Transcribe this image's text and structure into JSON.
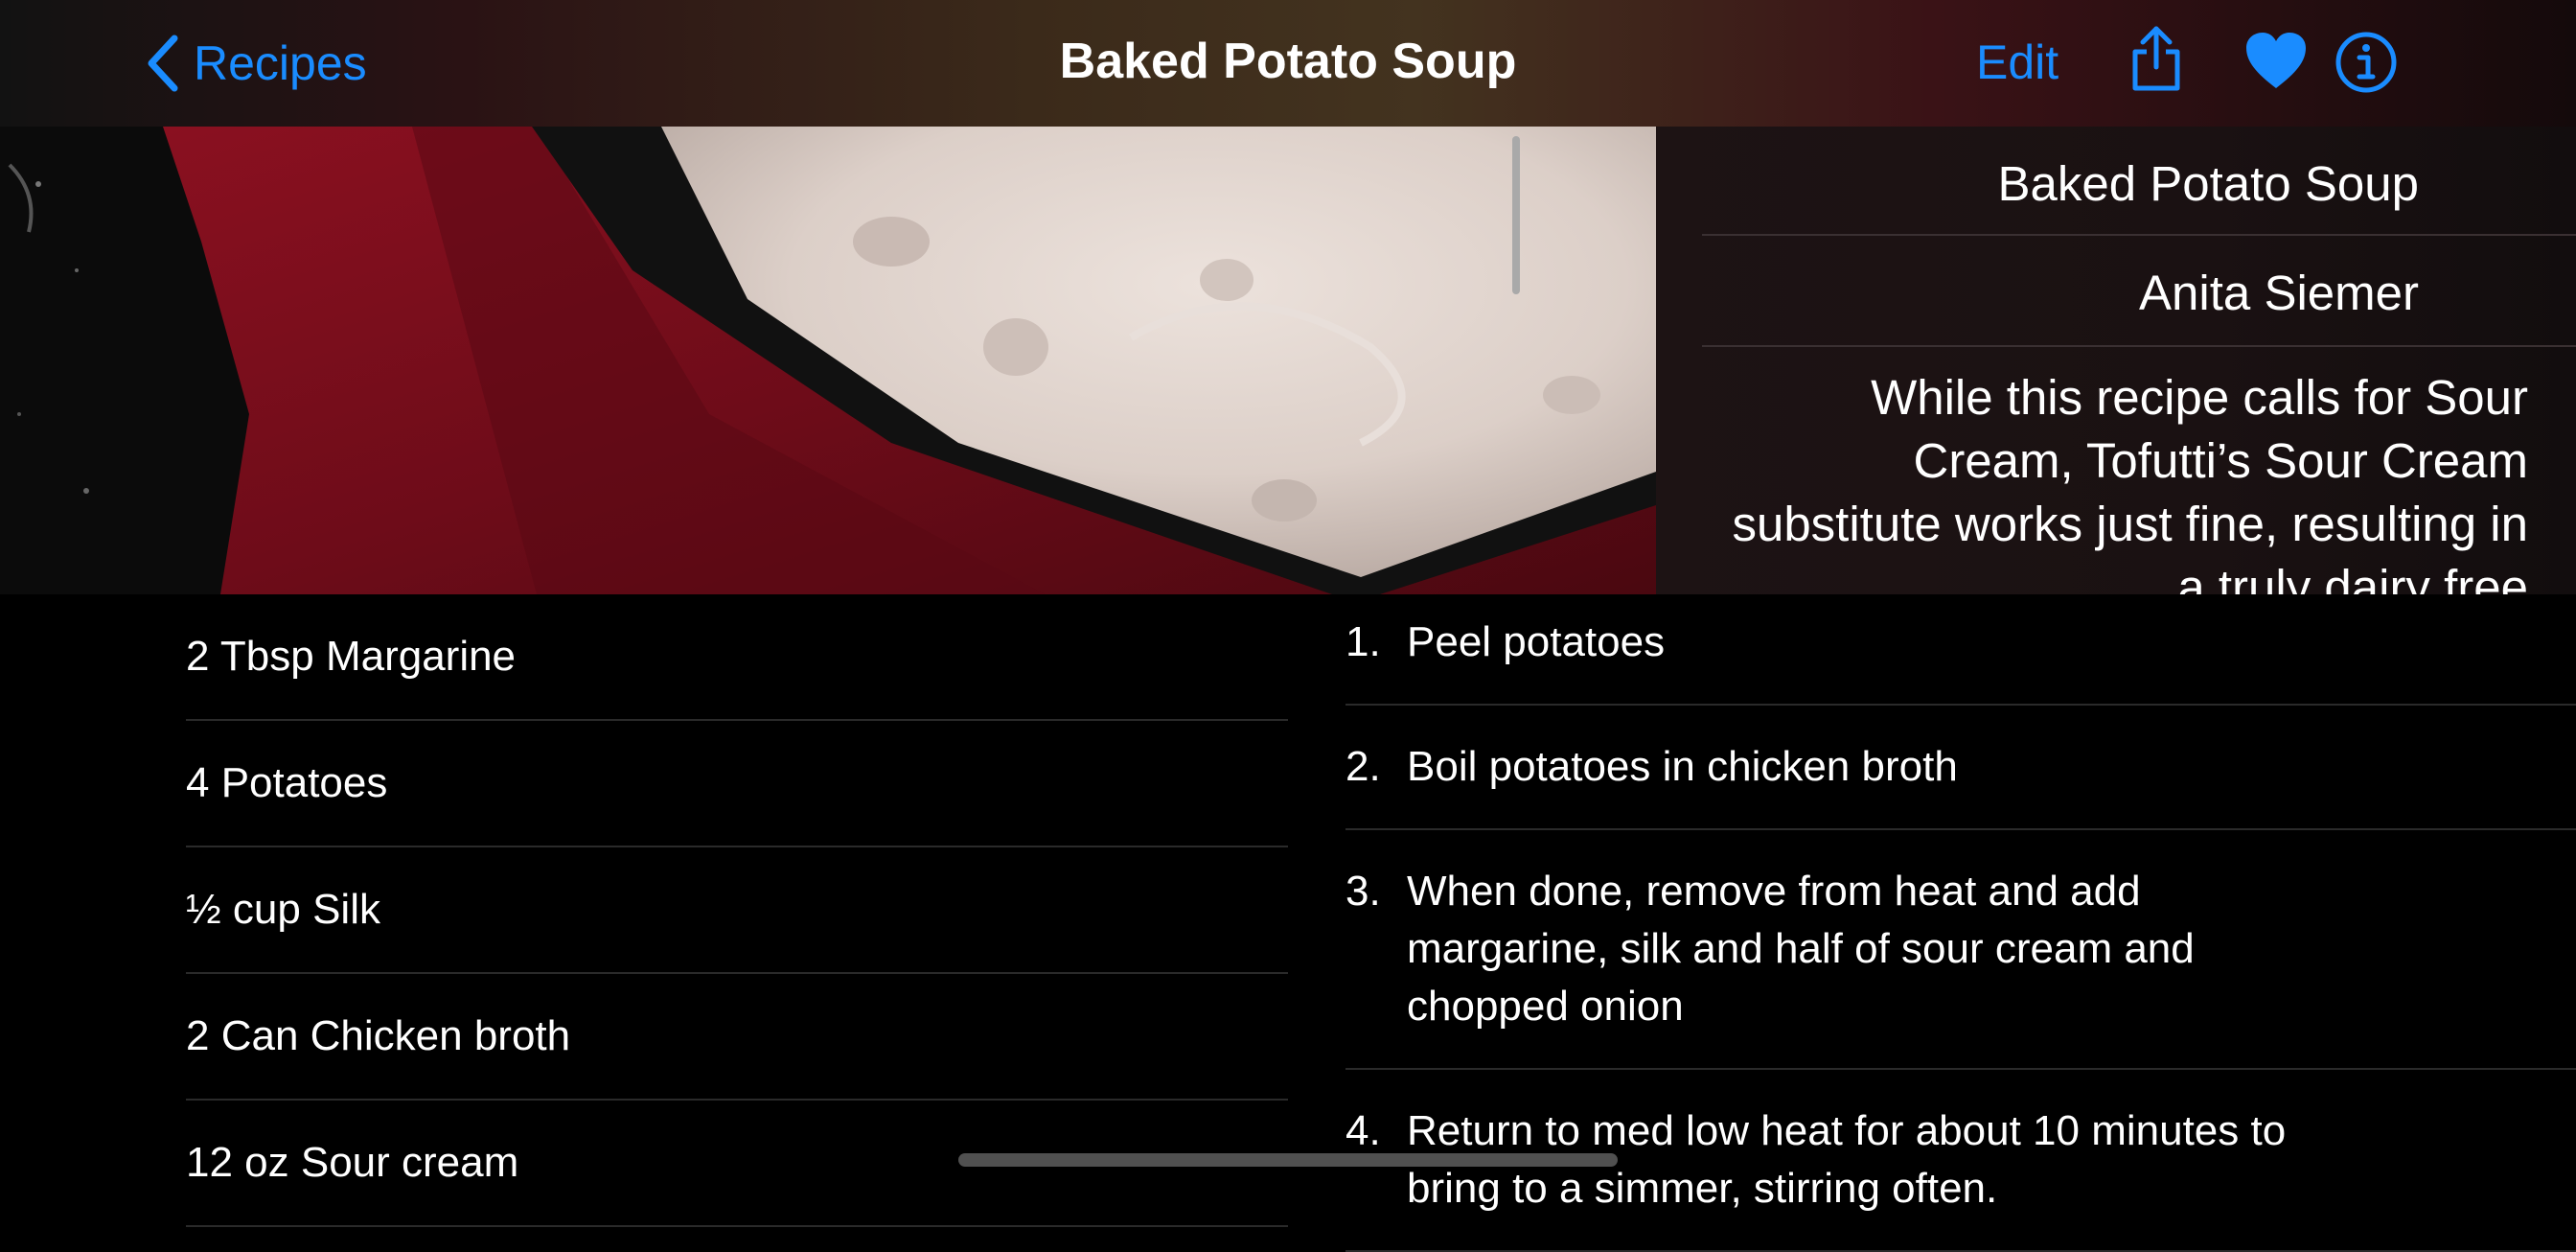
{
  "nav": {
    "back_label": "Recipes",
    "title": "Baked Potato Soup",
    "edit_label": "Edit",
    "accent_color": "#1a8cff"
  },
  "info": {
    "name": "Baked Potato Soup",
    "author": "Anita Siemer",
    "description": "While this recipe calls for Sour Cream, Tofutti’s Sour Cream substitute works just fine, resulting in a truly dairy free"
  },
  "ingredients": [
    "2 Tbsp Margarine",
    "4 Potatoes",
    "½ cup Silk",
    "2 Can Chicken broth",
    "12 oz Sour cream"
  ],
  "directions": [
    {
      "num": "1.",
      "text": "Peel potatoes"
    },
    {
      "num": "2.",
      "text": "Boil potatoes in chicken broth"
    },
    {
      "num": "3.",
      "text": "When done, remove from heat and add margarine, silk and half of sour cream and chopped onion"
    },
    {
      "num": "4.",
      "text": "Return to med low heat for about 10 minutes to bring to a simmer, stirring often."
    }
  ]
}
